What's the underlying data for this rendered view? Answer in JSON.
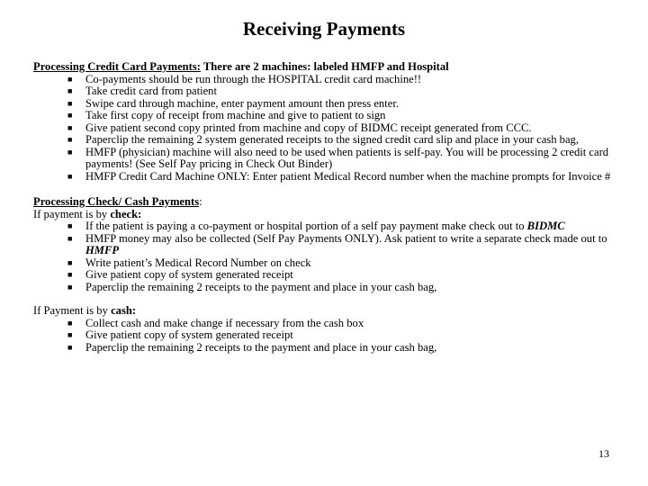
{
  "title": "Receiving Payments",
  "credit_section": {
    "heading_underlined": "Processing Credit Card Payments:",
    "heading_rest": " There are 2 machines: labeled HMFP and Hospital",
    "items": [
      "Co-payments should be run through the HOSPITAL credit card machine!!",
      "Take credit card from patient",
      "Swipe card through machine, enter payment amount then press enter.",
      "Take first copy of receipt from machine and give to patient to sign",
      "Give patient second copy printed from machine and copy of BIDMC receipt generated from CCC.",
      "Paperclip the remaining 2 system generated receipts to the signed credit card slip and place in your cash bag,",
      "HMFP (physician) machine will also need to be used when patients is self-pay. You will be processing 2 credit card payments! (See Self Pay pricing in Check Out Binder)",
      "HMFP Credit Card Machine ONLY: Enter patient Medical Record number when the machine prompts for Invoice #"
    ]
  },
  "check_cash_section": {
    "heading_underlined": "Processing Check/ Cash Payments",
    "heading_rest": ":",
    "check_intro": "If payment is by ",
    "check_intro_bold": "check:",
    "check_items": {
      "item1_text": "If the patient is paying a co-payment or hospital portion of a self pay payment make check out to ",
      "item1_emph": "BIDMC",
      "item2_text": "HMFP money may also be collected (Self Pay Payments ONLY). Ask patient to write a separate check made out to ",
      "item2_emph": "HMFP",
      "item3": "Write patient’s Medical Record Number on check",
      "item4": "Give patient copy of system generated receipt",
      "item5": "Paperclip the remaining 2 receipts to the payment and place in your cash bag,"
    },
    "cash_intro": "If Payment is by ",
    "cash_intro_bold": "cash:",
    "cash_items": [
      "Collect cash and make change if necessary from the cash box",
      "Give patient copy of system generated receipt",
      "Paperclip the remaining 2 receipts to the payment and place in your cash bag,"
    ]
  },
  "bullet_glyph": "■",
  "page_number": "13"
}
